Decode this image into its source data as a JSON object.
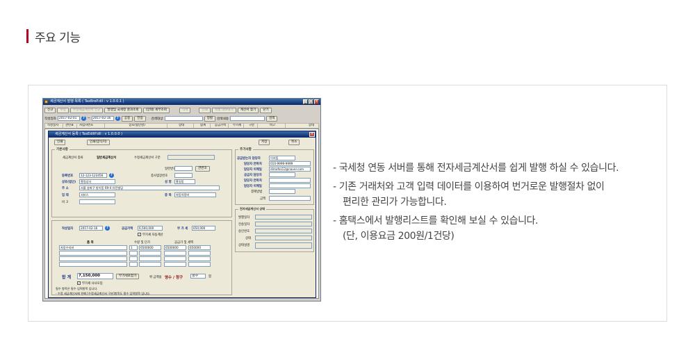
{
  "section": {
    "title": "주요 기능"
  },
  "features": [
    "- 국세청 연동 서버를 통해 전자세금계산서를 쉽게 발행 하실 수 있습니다.",
    "- 기존 거래처와 고객 입력 데이터를 이용하여 번거로운 발행절차 없이",
    "편리한 관리가 가능합니다.",
    "- 홈택스에서 발행리스트를 확인해 보실 수 있습니다.",
    "(단, 이용요금 200원/1건당)"
  ],
  "app": {
    "title": "세금계산서 발행 목록 ( TaxBreP.dll : v 1.0.0.1 )",
    "toolbar": [
      "신규",
      "수정",
      "수정세금계산서 신규",
      "발행및 국세청 결과조회",
      "(상태) 세부조회",
      "삭제",
      "인쇄",
      "엑셀 내보내기",
      "계산서 찾기",
      "닫기"
    ],
    "filter": {
      "date_label": "작성일자",
      "date_from": "2017-02-01",
      "date_to": "2017-02-16",
      "btn_query": "공용",
      "btn_all": "전용",
      "type_label": "검색대상",
      "btn_clear": "정렬",
      "keyword_label": "검색내용",
      "btn_search": "검색"
    },
    "columns": [
      "작성일자",
      "관련표",
      "사업자번호",
      "상호(법인명)",
      "상태",
      "합계",
      "공급가액",
      "부가세",
      "구분",
      "비고",
      "상태"
    ],
    "editor": {
      "title": "세금계산서 등록 ( TaxEditP.dll : v 1.0.0.0 )",
      "btn_print": "인쇄",
      "btn_print2": "인쇄(양식지)",
      "btn_save": "저장",
      "btn_cancel": "취소",
      "basic_title": "기본사항",
      "invoice_type_label": "세금계산서 종류",
      "invoice_type_value": "일반세금계산서",
      "modify_label": "수정세금계산서 구분",
      "serial_label": "일련번호",
      "branch_label": "종사업장번호",
      "btn_related": "관번호",
      "reg_no_label": "등록번호",
      "reg_no_value": "12-123-123456",
      "branch_no_value": "",
      "company_label": "상호(법인)",
      "company_value": "흥림상사",
      "ceo_label": "성 명",
      "ceo_value": "홍길동",
      "addr_label": "주 소",
      "addr_value": "서울 송파구 방이동 69-4 유진빌딩",
      "biz_label": "업 태",
      "biz_value": "서비스",
      "item_label": "종 목",
      "item_value": "자동차정비",
      "note_label": "비 고",
      "add_title": "추가사항",
      "contact_label": "공급받는자 담당자",
      "contact_value": "이지동",
      "contact_tel_label": "담당자 연락처",
      "contact_tel_value": "010-9999-9999",
      "contact_email_label": "담당자 이메일",
      "contact_email_value": "dimofos12@naver.com",
      "sup_label": "공급자 담당자",
      "sup_tel_label": "담당자 연락처",
      "sup_email_label": "담당자 이메일",
      "pay_label": "결제방법",
      "amount_label": "금액",
      "date_label": "작성일자",
      "date_value": "2017-02-16",
      "supply_label": "공급가액",
      "supply_value": "6,500,000",
      "vat_label": "부 가 세",
      "vat_value": "650,000",
      "vat_auto": "부가세 자동계산",
      "col_item": "품 목",
      "col_qty": "수량 및 단가",
      "col_supply": "공급가 및 세액",
      "row_item": "자동수리비",
      "row_qty": "1",
      "row_price": "6500000",
      "row_supply": "6500000",
      "row_vat": "650000",
      "total_label": "합 계",
      "total_value": "7,150,000",
      "btn_vat_to_supply": "부가세포함가",
      "words_label": "위 금액을",
      "receipt_label": "영수 / 청구",
      "receipt_value": "영수",
      "receipt_suffix": "함",
      "vat_checkbox": "부가세 사사오입",
      "note1": "필수 항목은 필수 입력항목 입니다.",
      "note2": "- 수정 세금계산서에 한해 [수정세금계산서 구분]항목도 필수 입력항목 입니다.",
      "status_title": "전자세금계산서 상태",
      "status_rows": [
        "발행일자",
        "전송일자",
        "승인번호",
        "상태",
        "상태설명"
      ]
    }
  }
}
